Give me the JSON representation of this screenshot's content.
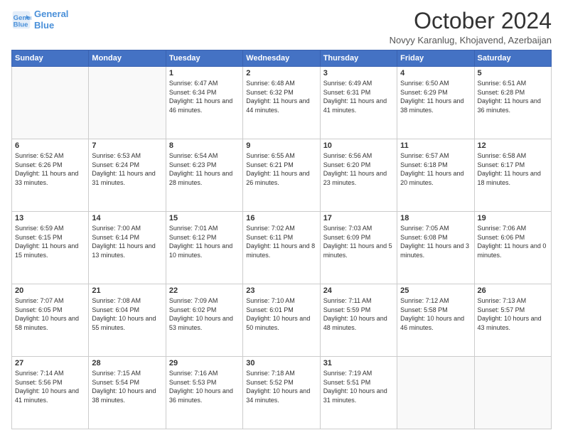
{
  "header": {
    "logo_line1": "General",
    "logo_line2": "Blue",
    "title": "October 2024",
    "subtitle": "Novyy Karanlug, Khojavend, Azerbaijan"
  },
  "days_of_week": [
    "Sunday",
    "Monday",
    "Tuesday",
    "Wednesday",
    "Thursday",
    "Friday",
    "Saturday"
  ],
  "weeks": [
    [
      {
        "day": "",
        "sunrise": "",
        "sunset": "",
        "daylight": ""
      },
      {
        "day": "",
        "sunrise": "",
        "sunset": "",
        "daylight": ""
      },
      {
        "day": "1",
        "sunrise": "Sunrise: 6:47 AM",
        "sunset": "Sunset: 6:34 PM",
        "daylight": "Daylight: 11 hours and 46 minutes."
      },
      {
        "day": "2",
        "sunrise": "Sunrise: 6:48 AM",
        "sunset": "Sunset: 6:32 PM",
        "daylight": "Daylight: 11 hours and 44 minutes."
      },
      {
        "day": "3",
        "sunrise": "Sunrise: 6:49 AM",
        "sunset": "Sunset: 6:31 PM",
        "daylight": "Daylight: 11 hours and 41 minutes."
      },
      {
        "day": "4",
        "sunrise": "Sunrise: 6:50 AM",
        "sunset": "Sunset: 6:29 PM",
        "daylight": "Daylight: 11 hours and 38 minutes."
      },
      {
        "day": "5",
        "sunrise": "Sunrise: 6:51 AM",
        "sunset": "Sunset: 6:28 PM",
        "daylight": "Daylight: 11 hours and 36 minutes."
      }
    ],
    [
      {
        "day": "6",
        "sunrise": "Sunrise: 6:52 AM",
        "sunset": "Sunset: 6:26 PM",
        "daylight": "Daylight: 11 hours and 33 minutes."
      },
      {
        "day": "7",
        "sunrise": "Sunrise: 6:53 AM",
        "sunset": "Sunset: 6:24 PM",
        "daylight": "Daylight: 11 hours and 31 minutes."
      },
      {
        "day": "8",
        "sunrise": "Sunrise: 6:54 AM",
        "sunset": "Sunset: 6:23 PM",
        "daylight": "Daylight: 11 hours and 28 minutes."
      },
      {
        "day": "9",
        "sunrise": "Sunrise: 6:55 AM",
        "sunset": "Sunset: 6:21 PM",
        "daylight": "Daylight: 11 hours and 26 minutes."
      },
      {
        "day": "10",
        "sunrise": "Sunrise: 6:56 AM",
        "sunset": "Sunset: 6:20 PM",
        "daylight": "Daylight: 11 hours and 23 minutes."
      },
      {
        "day": "11",
        "sunrise": "Sunrise: 6:57 AM",
        "sunset": "Sunset: 6:18 PM",
        "daylight": "Daylight: 11 hours and 20 minutes."
      },
      {
        "day": "12",
        "sunrise": "Sunrise: 6:58 AM",
        "sunset": "Sunset: 6:17 PM",
        "daylight": "Daylight: 11 hours and 18 minutes."
      }
    ],
    [
      {
        "day": "13",
        "sunrise": "Sunrise: 6:59 AM",
        "sunset": "Sunset: 6:15 PM",
        "daylight": "Daylight: 11 hours and 15 minutes."
      },
      {
        "day": "14",
        "sunrise": "Sunrise: 7:00 AM",
        "sunset": "Sunset: 6:14 PM",
        "daylight": "Daylight: 11 hours and 13 minutes."
      },
      {
        "day": "15",
        "sunrise": "Sunrise: 7:01 AM",
        "sunset": "Sunset: 6:12 PM",
        "daylight": "Daylight: 11 hours and 10 minutes."
      },
      {
        "day": "16",
        "sunrise": "Sunrise: 7:02 AM",
        "sunset": "Sunset: 6:11 PM",
        "daylight": "Daylight: 11 hours and 8 minutes."
      },
      {
        "day": "17",
        "sunrise": "Sunrise: 7:03 AM",
        "sunset": "Sunset: 6:09 PM",
        "daylight": "Daylight: 11 hours and 5 minutes."
      },
      {
        "day": "18",
        "sunrise": "Sunrise: 7:05 AM",
        "sunset": "Sunset: 6:08 PM",
        "daylight": "Daylight: 11 hours and 3 minutes."
      },
      {
        "day": "19",
        "sunrise": "Sunrise: 7:06 AM",
        "sunset": "Sunset: 6:06 PM",
        "daylight": "Daylight: 11 hours and 0 minutes."
      }
    ],
    [
      {
        "day": "20",
        "sunrise": "Sunrise: 7:07 AM",
        "sunset": "Sunset: 6:05 PM",
        "daylight": "Daylight: 10 hours and 58 minutes."
      },
      {
        "day": "21",
        "sunrise": "Sunrise: 7:08 AM",
        "sunset": "Sunset: 6:04 PM",
        "daylight": "Daylight: 10 hours and 55 minutes."
      },
      {
        "day": "22",
        "sunrise": "Sunrise: 7:09 AM",
        "sunset": "Sunset: 6:02 PM",
        "daylight": "Daylight: 10 hours and 53 minutes."
      },
      {
        "day": "23",
        "sunrise": "Sunrise: 7:10 AM",
        "sunset": "Sunset: 6:01 PM",
        "daylight": "Daylight: 10 hours and 50 minutes."
      },
      {
        "day": "24",
        "sunrise": "Sunrise: 7:11 AM",
        "sunset": "Sunset: 5:59 PM",
        "daylight": "Daylight: 10 hours and 48 minutes."
      },
      {
        "day": "25",
        "sunrise": "Sunrise: 7:12 AM",
        "sunset": "Sunset: 5:58 PM",
        "daylight": "Daylight: 10 hours and 46 minutes."
      },
      {
        "day": "26",
        "sunrise": "Sunrise: 7:13 AM",
        "sunset": "Sunset: 5:57 PM",
        "daylight": "Daylight: 10 hours and 43 minutes."
      }
    ],
    [
      {
        "day": "27",
        "sunrise": "Sunrise: 7:14 AM",
        "sunset": "Sunset: 5:56 PM",
        "daylight": "Daylight: 10 hours and 41 minutes."
      },
      {
        "day": "28",
        "sunrise": "Sunrise: 7:15 AM",
        "sunset": "Sunset: 5:54 PM",
        "daylight": "Daylight: 10 hours and 38 minutes."
      },
      {
        "day": "29",
        "sunrise": "Sunrise: 7:16 AM",
        "sunset": "Sunset: 5:53 PM",
        "daylight": "Daylight: 10 hours and 36 minutes."
      },
      {
        "day": "30",
        "sunrise": "Sunrise: 7:18 AM",
        "sunset": "Sunset: 5:52 PM",
        "daylight": "Daylight: 10 hours and 34 minutes."
      },
      {
        "day": "31",
        "sunrise": "Sunrise: 7:19 AM",
        "sunset": "Sunset: 5:51 PM",
        "daylight": "Daylight: 10 hours and 31 minutes."
      },
      {
        "day": "",
        "sunrise": "",
        "sunset": "",
        "daylight": ""
      },
      {
        "day": "",
        "sunrise": "",
        "sunset": "",
        "daylight": ""
      }
    ]
  ]
}
